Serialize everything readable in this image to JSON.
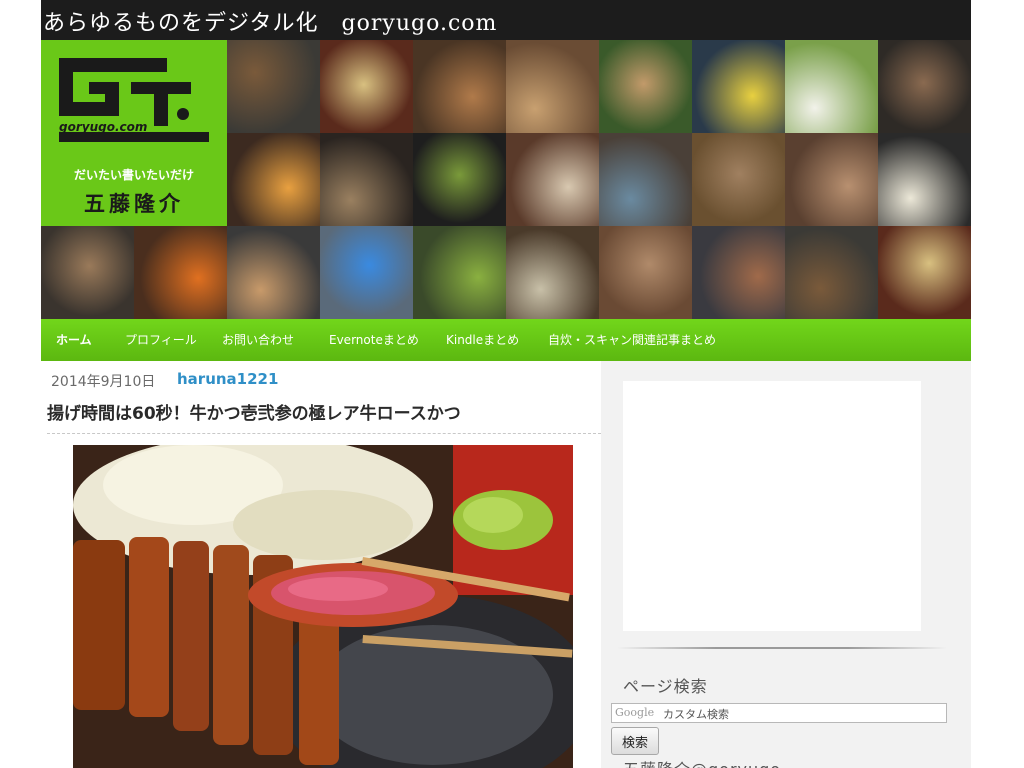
{
  "site": {
    "title": "あらゆるものをデジタル化　goryugo.com"
  },
  "logo": {
    "domain": "goryugo.com",
    "tagline": "だいたい書いたいだけ",
    "name": "五藤隆介"
  },
  "nav": {
    "items": [
      {
        "label": "ホーム",
        "active": true
      },
      {
        "label": "プロフィール"
      },
      {
        "label": "お問い合わせ"
      },
      {
        "label": "Evernoteまとめ"
      },
      {
        "label": "Kindleまとめ"
      },
      {
        "label": "自炊・スキャン関連記事まとめ"
      }
    ]
  },
  "post": {
    "date": "2014年9月10日",
    "author": "haruna1221",
    "title": "揚げ時間は60秒！牛かつ壱弐参の極レア牛ロースかつ"
  },
  "sidebar": {
    "search": {
      "heading": "ページ検索",
      "brand": "Google",
      "field_label": "カスタム検索",
      "button": "検索"
    },
    "profile_heading": "五藤隆介@goryugo"
  },
  "colors": {
    "brand_green": "#6ac818",
    "nav_green": "#5cb810",
    "author_link": "#2f8fc7",
    "title_bar": "#1c1c1c"
  }
}
